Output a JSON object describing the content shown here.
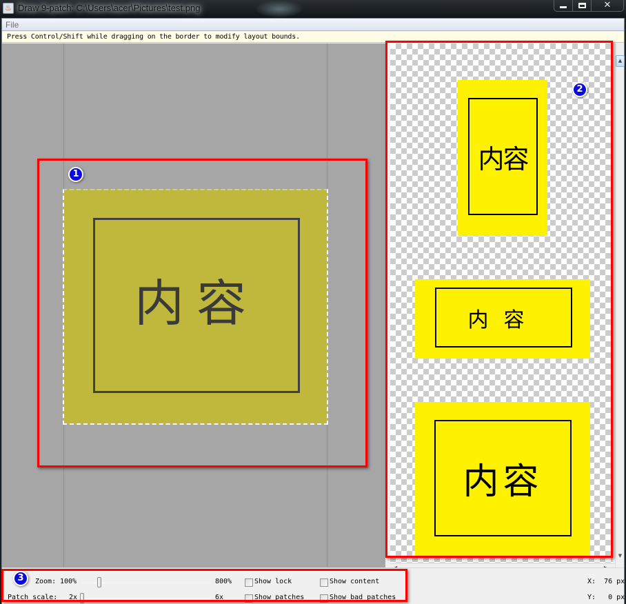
{
  "window": {
    "title": "Draw 9-patch: C:\\Users\\acer\\Pictures\\test.png",
    "app_icon": "java-icon",
    "controls": {
      "minimize": "minimize-icon",
      "maximize": "maximize-icon",
      "close_glyph": "✕"
    }
  },
  "menu": {
    "items": [
      {
        "label": "File"
      }
    ]
  },
  "hint": "Press Control/Shift while dragging on the border to modify layout bounds.",
  "editor": {
    "image_text": "内容",
    "image_color": "#bfb83d"
  },
  "preview": {
    "images": [
      {
        "name": "tall",
        "text": "内容"
      },
      {
        "name": "wide",
        "text": "内容"
      },
      {
        "name": "large",
        "text": "内容"
      }
    ],
    "fill_color": "#fff200"
  },
  "annotations": [
    {
      "label": "1"
    },
    {
      "label": "2"
    },
    {
      "label": "3"
    }
  ],
  "controls": {
    "zoom": {
      "label": "Zoom:",
      "min_label": "100%",
      "max_label": "800%",
      "value_percent": 100,
      "range": [
        100,
        800
      ]
    },
    "patch_scale": {
      "label": "Patch scale:",
      "min_label": "2x",
      "max_label": "6x",
      "value": 2,
      "range": [
        2,
        6
      ]
    },
    "checkboxes": [
      {
        "label": "Show lock",
        "checked": false
      },
      {
        "label": "Show patches",
        "checked": false
      },
      {
        "label": "Show content",
        "checked": false
      },
      {
        "label": "Show bad patches",
        "checked": false
      }
    ],
    "coords": {
      "x": "X:  76 px",
      "y": "Y:   0 px"
    }
  },
  "scrollbars": {
    "up": "▲",
    "down": "▼",
    "left": "◀",
    "right": "▶"
  }
}
